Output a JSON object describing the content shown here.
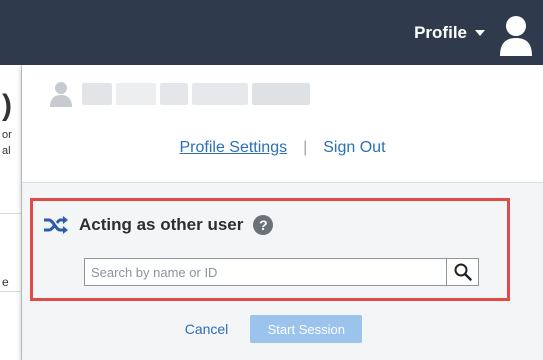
{
  "header": {
    "profile_label": "Profile",
    "avatar_icon": "user-avatar-icon",
    "caret_icon": "caret-down-icon",
    "background_color": "#2f3b4c"
  },
  "background_page": {
    "glyphs": [
      ")",
      "or",
      "al",
      "e"
    ]
  },
  "profile_menu": {
    "user_avatar_icon": "user-avatar-icon",
    "user_name": "",
    "links": {
      "settings": "Profile Settings",
      "separator": "|",
      "sign_out": "Sign Out"
    }
  },
  "acting_as": {
    "icon": "shuffle-icon",
    "title": "Acting as other user",
    "help_icon": "help-icon",
    "help_glyph": "?",
    "search": {
      "placeholder": "Search by name or ID",
      "value": "",
      "button_icon": "search-icon"
    },
    "highlight_color": "#e24a4a"
  },
  "actions": {
    "cancel_label": "Cancel",
    "start_label": "Start Session",
    "start_enabled": false
  },
  "colors": {
    "link": "#2c6fb7",
    "start_button_disabled": "#9cc3ec"
  }
}
